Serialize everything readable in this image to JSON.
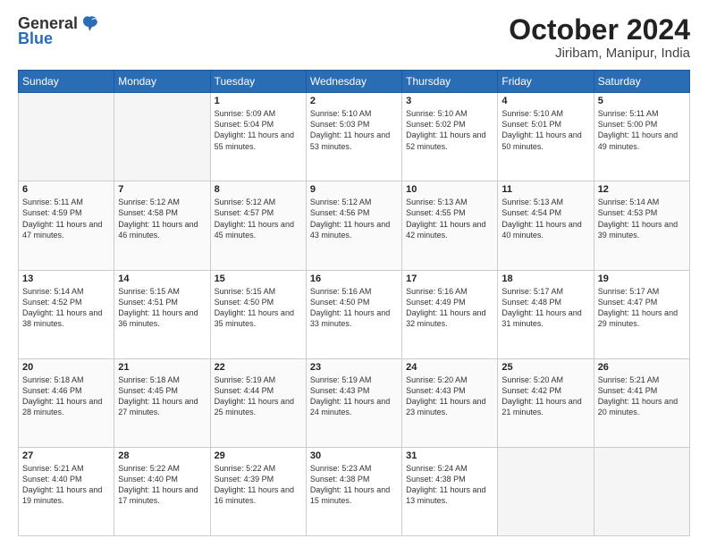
{
  "header": {
    "logo_general": "General",
    "logo_blue": "Blue",
    "month": "October 2024",
    "location": "Jiribam, Manipur, India"
  },
  "days_of_week": [
    "Sunday",
    "Monday",
    "Tuesday",
    "Wednesday",
    "Thursday",
    "Friday",
    "Saturday"
  ],
  "weeks": [
    [
      {
        "day": "",
        "empty": true
      },
      {
        "day": "",
        "empty": true
      },
      {
        "day": "1",
        "sunrise": "Sunrise: 5:09 AM",
        "sunset": "Sunset: 5:04 PM",
        "daylight": "Daylight: 11 hours and 55 minutes."
      },
      {
        "day": "2",
        "sunrise": "Sunrise: 5:10 AM",
        "sunset": "Sunset: 5:03 PM",
        "daylight": "Daylight: 11 hours and 53 minutes."
      },
      {
        "day": "3",
        "sunrise": "Sunrise: 5:10 AM",
        "sunset": "Sunset: 5:02 PM",
        "daylight": "Daylight: 11 hours and 52 minutes."
      },
      {
        "day": "4",
        "sunrise": "Sunrise: 5:10 AM",
        "sunset": "Sunset: 5:01 PM",
        "daylight": "Daylight: 11 hours and 50 minutes."
      },
      {
        "day": "5",
        "sunrise": "Sunrise: 5:11 AM",
        "sunset": "Sunset: 5:00 PM",
        "daylight": "Daylight: 11 hours and 49 minutes."
      }
    ],
    [
      {
        "day": "6",
        "sunrise": "Sunrise: 5:11 AM",
        "sunset": "Sunset: 4:59 PM",
        "daylight": "Daylight: 11 hours and 47 minutes."
      },
      {
        "day": "7",
        "sunrise": "Sunrise: 5:12 AM",
        "sunset": "Sunset: 4:58 PM",
        "daylight": "Daylight: 11 hours and 46 minutes."
      },
      {
        "day": "8",
        "sunrise": "Sunrise: 5:12 AM",
        "sunset": "Sunset: 4:57 PM",
        "daylight": "Daylight: 11 hours and 45 minutes."
      },
      {
        "day": "9",
        "sunrise": "Sunrise: 5:12 AM",
        "sunset": "Sunset: 4:56 PM",
        "daylight": "Daylight: 11 hours and 43 minutes."
      },
      {
        "day": "10",
        "sunrise": "Sunrise: 5:13 AM",
        "sunset": "Sunset: 4:55 PM",
        "daylight": "Daylight: 11 hours and 42 minutes."
      },
      {
        "day": "11",
        "sunrise": "Sunrise: 5:13 AM",
        "sunset": "Sunset: 4:54 PM",
        "daylight": "Daylight: 11 hours and 40 minutes."
      },
      {
        "day": "12",
        "sunrise": "Sunrise: 5:14 AM",
        "sunset": "Sunset: 4:53 PM",
        "daylight": "Daylight: 11 hours and 39 minutes."
      }
    ],
    [
      {
        "day": "13",
        "sunrise": "Sunrise: 5:14 AM",
        "sunset": "Sunset: 4:52 PM",
        "daylight": "Daylight: 11 hours and 38 minutes."
      },
      {
        "day": "14",
        "sunrise": "Sunrise: 5:15 AM",
        "sunset": "Sunset: 4:51 PM",
        "daylight": "Daylight: 11 hours and 36 minutes."
      },
      {
        "day": "15",
        "sunrise": "Sunrise: 5:15 AM",
        "sunset": "Sunset: 4:50 PM",
        "daylight": "Daylight: 11 hours and 35 minutes."
      },
      {
        "day": "16",
        "sunrise": "Sunrise: 5:16 AM",
        "sunset": "Sunset: 4:50 PM",
        "daylight": "Daylight: 11 hours and 33 minutes."
      },
      {
        "day": "17",
        "sunrise": "Sunrise: 5:16 AM",
        "sunset": "Sunset: 4:49 PM",
        "daylight": "Daylight: 11 hours and 32 minutes."
      },
      {
        "day": "18",
        "sunrise": "Sunrise: 5:17 AM",
        "sunset": "Sunset: 4:48 PM",
        "daylight": "Daylight: 11 hours and 31 minutes."
      },
      {
        "day": "19",
        "sunrise": "Sunrise: 5:17 AM",
        "sunset": "Sunset: 4:47 PM",
        "daylight": "Daylight: 11 hours and 29 minutes."
      }
    ],
    [
      {
        "day": "20",
        "sunrise": "Sunrise: 5:18 AM",
        "sunset": "Sunset: 4:46 PM",
        "daylight": "Daylight: 11 hours and 28 minutes."
      },
      {
        "day": "21",
        "sunrise": "Sunrise: 5:18 AM",
        "sunset": "Sunset: 4:45 PM",
        "daylight": "Daylight: 11 hours and 27 minutes."
      },
      {
        "day": "22",
        "sunrise": "Sunrise: 5:19 AM",
        "sunset": "Sunset: 4:44 PM",
        "daylight": "Daylight: 11 hours and 25 minutes."
      },
      {
        "day": "23",
        "sunrise": "Sunrise: 5:19 AM",
        "sunset": "Sunset: 4:43 PM",
        "daylight": "Daylight: 11 hours and 24 minutes."
      },
      {
        "day": "24",
        "sunrise": "Sunrise: 5:20 AM",
        "sunset": "Sunset: 4:43 PM",
        "daylight": "Daylight: 11 hours and 23 minutes."
      },
      {
        "day": "25",
        "sunrise": "Sunrise: 5:20 AM",
        "sunset": "Sunset: 4:42 PM",
        "daylight": "Daylight: 11 hours and 21 minutes."
      },
      {
        "day": "26",
        "sunrise": "Sunrise: 5:21 AM",
        "sunset": "Sunset: 4:41 PM",
        "daylight": "Daylight: 11 hours and 20 minutes."
      }
    ],
    [
      {
        "day": "27",
        "sunrise": "Sunrise: 5:21 AM",
        "sunset": "Sunset: 4:40 PM",
        "daylight": "Daylight: 11 hours and 19 minutes."
      },
      {
        "day": "28",
        "sunrise": "Sunrise: 5:22 AM",
        "sunset": "Sunset: 4:40 PM",
        "daylight": "Daylight: 11 hours and 17 minutes."
      },
      {
        "day": "29",
        "sunrise": "Sunrise: 5:22 AM",
        "sunset": "Sunset: 4:39 PM",
        "daylight": "Daylight: 11 hours and 16 minutes."
      },
      {
        "day": "30",
        "sunrise": "Sunrise: 5:23 AM",
        "sunset": "Sunset: 4:38 PM",
        "daylight": "Daylight: 11 hours and 15 minutes."
      },
      {
        "day": "31",
        "sunrise": "Sunrise: 5:24 AM",
        "sunset": "Sunset: 4:38 PM",
        "daylight": "Daylight: 11 hours and 13 minutes."
      },
      {
        "day": "",
        "empty": true
      },
      {
        "day": "",
        "empty": true
      }
    ]
  ]
}
